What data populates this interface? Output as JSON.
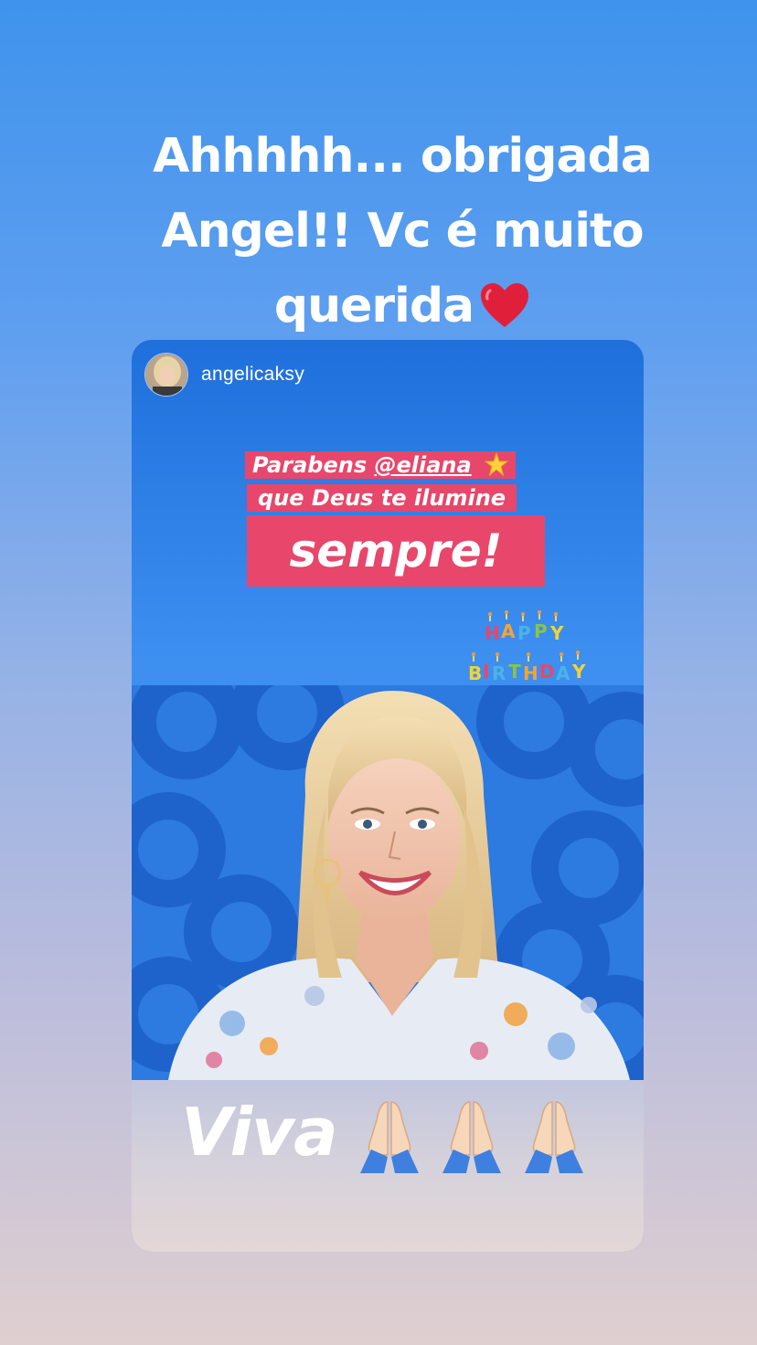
{
  "caption": {
    "lines": [
      "Ahhhhh... obrigada",
      "Angel!! Vc é muito",
      "querida"
    ],
    "trailing_icon": "heart-icon"
  },
  "shared_post": {
    "username": "angelicaksy",
    "avatar_icon": "profile-avatar",
    "sticker_line1_prefix": "Parabens ",
    "sticker_mention": "@eliana",
    "sticker_line1_icon": "star-icon",
    "sticker_line2": "que Deus te ilumine",
    "sticker_line3": "sempre!",
    "birthday_sticker_icon": "happy-birthday-sticker",
    "photo": "smiling-blonde-woman-photo",
    "footer_text": "Viva",
    "footer_icons": [
      "pray-icon",
      "pray-icon",
      "pray-icon"
    ]
  },
  "colors": {
    "background_top": "#3f93ec",
    "background_bottom": "#dfcfd0",
    "sticker_highlight": "#e8466a",
    "heart": "#e0203a"
  }
}
